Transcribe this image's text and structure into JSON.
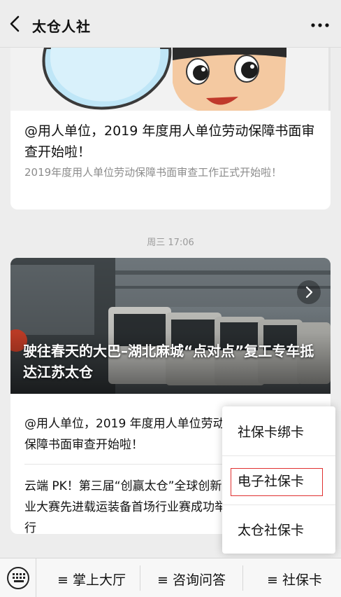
{
  "header": {
    "title": "太仓人社"
  },
  "card1": {
    "title": "@用人单位，2019 年度用人单位劳动保障书面审查开始啦！",
    "desc": "2019年度用人单位劳动保障书面审查工作正式开始啦！"
  },
  "timestamp": "周三 17:06",
  "card2": {
    "headline": "驶往春天的大巴–湖北麻城“点对点”复工专车抵达江苏太仓",
    "articles": [
      "@用人单位，2019 年度用人单位劳动保障书面审查开始啦！",
      "云端 PK！第三届“创赢太仓”全球创新创业大赛先进载运装备首场行业赛成功举行"
    ]
  },
  "popup": {
    "items": [
      "社保卡绑卡",
      "电子社保卡",
      "太仓社保卡"
    ],
    "selected": "电子社保卡"
  },
  "bottom_menu": {
    "items": [
      "≡ 掌上大厅",
      "≡ 咨询问答",
      "≡ 社保卡"
    ]
  },
  "icons": {
    "back": "chevron-left-icon",
    "more": "more-dots-icon",
    "keyboard": "keyboard-icon",
    "next": "chevron-right-icon"
  },
  "colors": {
    "background": "#ededed",
    "card": "#ffffff",
    "highlight_border": "#e03030",
    "secondary_text": "#8c8c8c"
  }
}
